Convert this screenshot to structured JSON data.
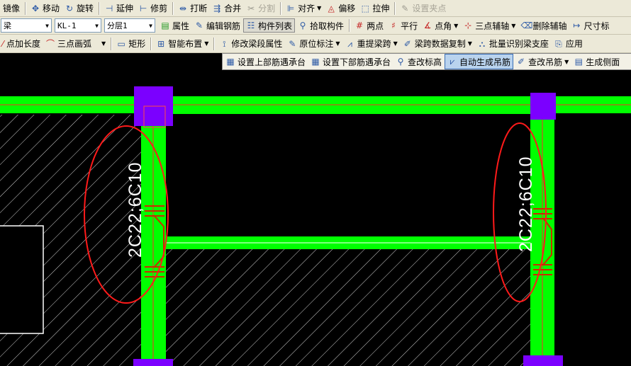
{
  "toolbar1": {
    "mirror": "镜像",
    "move": "移动",
    "rotate": "旋转",
    "extend": "延伸",
    "trim": "修剪",
    "break": "打断",
    "merge": "合并",
    "split": "分割",
    "align": "对齐",
    "offset": "偏移",
    "stretch": "拉伸",
    "set_grip": "设置夹点"
  },
  "toolbar2": {
    "type_select": "梁",
    "name_select": "KL-1",
    "layer_select": "分层1",
    "properties": "属性",
    "edit_rebar": "编辑钢筋",
    "component_list": "构件列表",
    "pick_component": "拾取构件",
    "two_points": "两点",
    "parallel": "平行",
    "point_angle": "点角",
    "three_point_axis": "三点辅轴",
    "delete_axis": "删除辅轴",
    "dimension": "尺寸标"
  },
  "toolbar3": {
    "point_length": "点加长度",
    "three_point_arc": "三点画弧",
    "rectangle": "矩形",
    "smart_layout": "智能布置",
    "modify_segment_props": "修改梁段属性",
    "in_situ_label": "原位标注",
    "re_span": "重提梁跨",
    "copy_span_data": "梁跨数据复制",
    "batch_identify_supports": "批量识别梁支座",
    "apply": "应用"
  },
  "toolbar4": {
    "set_top_cap": "设置上部筋遇承台",
    "set_bottom_cap": "设置下部筋遇承台",
    "check_elevation": "查改标高",
    "auto_hanger": "自动生成吊筋",
    "check_hanger": "查改吊筋",
    "gen_side": "生成侧面"
  },
  "canvas": {
    "hanger_label_left": "2C22;6C10",
    "hanger_label_right": "2C22;6C10"
  },
  "colors": {
    "toolbar_bg": "#ece9d8",
    "canvas_bg": "#000000",
    "beam": "#00ff00",
    "column": "#7b00ff",
    "annotation": "#ff1a1a",
    "hanger": "#cc2a00",
    "label": "#ffffff"
  }
}
